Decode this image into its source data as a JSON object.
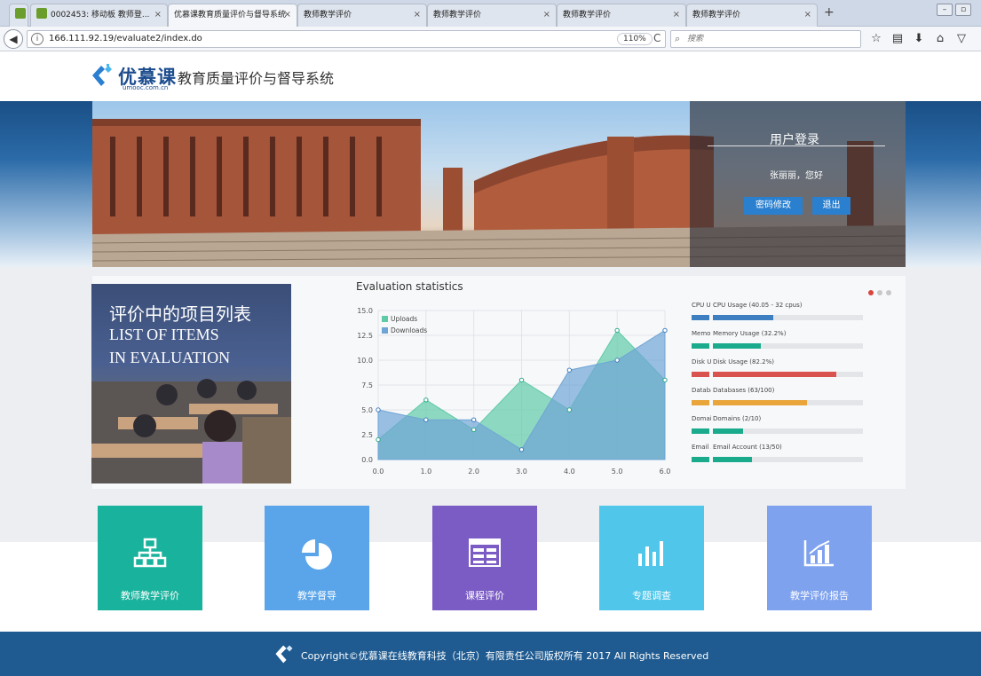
{
  "browser": {
    "tabs": [
      {
        "label": "0002453: 移动板 教师登...",
        "close": "×"
      },
      {
        "label": "优慕课教育质量评价与督导系统",
        "close": "×"
      },
      {
        "label": "教师教学评价",
        "close": "×"
      },
      {
        "label": "教师教学评价",
        "close": "×"
      },
      {
        "label": "教师教学评价",
        "close": "×"
      },
      {
        "label": "教师教学评价",
        "close": "×"
      }
    ],
    "new_tab": "+",
    "url": "166.111.92.19/evaluate2/index.do",
    "zoom": "110%",
    "search_placeholder": "搜索"
  },
  "header": {
    "logo_text": "优慕课",
    "logo_sub": "umooc.com.cn",
    "title": "教育质量评价与督导系统"
  },
  "login": {
    "title": "用户登录",
    "greeting": "张丽丽，您好",
    "change_password": "密码修改",
    "logout": "退出"
  },
  "evaluation_image": {
    "title_cn": "评价中的项目列表",
    "title_en_1": "LIST OF ITEMS",
    "title_en_2": "IN EVALUATION"
  },
  "stats": {
    "title": "Evaluation statistics",
    "colors": {
      "uploads": "#5fcaa6",
      "downloads": "#6fa5d6"
    }
  },
  "chart_data": {
    "type": "area",
    "x": [
      0.0,
      1.0,
      2.0,
      3.0,
      4.0,
      5.0,
      6.0
    ],
    "x_tick_labels": [
      "0.0",
      "1.0",
      "2.0",
      "3.0",
      "4.0",
      "5.0",
      "6.0"
    ],
    "y_tick_labels": [
      "0.0",
      "2.5",
      "5.0",
      "7.5",
      "10.0",
      "12.5",
      "15.0"
    ],
    "ylim": [
      0,
      15
    ],
    "xlim": [
      0,
      6
    ],
    "grid": true,
    "legend_position": "top-left",
    "series": [
      {
        "name": "Uploads",
        "values": [
          2,
          6,
          3,
          8,
          5,
          13,
          8
        ]
      },
      {
        "name": "Downloads",
        "values": [
          5,
          4,
          4,
          1,
          9,
          10,
          13
        ]
      }
    ]
  },
  "usage": [
    {
      "short": "CPU Usage",
      "label": "CPU Usage (40.05 - 32 cpus)",
      "percent": 40,
      "color": "#3d7fc1"
    },
    {
      "short": "Memory Usage",
      "label": "Memory Usage (32.2%)",
      "percent": 32.2,
      "color": "#1aaa8c"
    },
    {
      "short": "Disk Usage",
      "label": "Disk Usage (82.2%)",
      "percent": 82.2,
      "color": "#d9534f"
    },
    {
      "short": "Databases",
      "label": "Databases (63/100)",
      "percent": 63,
      "color": "#e9a43a"
    },
    {
      "short": "Domains",
      "label": "Domains (2/10)",
      "percent": 20,
      "color": "#1aaa8c"
    },
    {
      "short": "Email Account",
      "label": "Email Account (13/50)",
      "percent": 26,
      "color": "#1aaa8c"
    }
  ],
  "tiles": [
    {
      "label": "教师教学评价",
      "color": "#19b29c",
      "icon": "sitemap-icon"
    },
    {
      "label": "教学督导",
      "color": "#5aa5ea",
      "icon": "pie-chart-icon"
    },
    {
      "label": "课程评价",
      "color": "#7b5cc4",
      "icon": "window-table-icon"
    },
    {
      "label": "专题调查",
      "color": "#4fc6ea",
      "icon": "bar-chart-icon"
    },
    {
      "label": "教学评价报告",
      "color": "#7fa2ee",
      "icon": "growth-chart-icon"
    }
  ],
  "footer": {
    "copyright": "Copyright©优慕课在线教育科技（北京）有限责任公司版权所有 2017 All Rights Reserved"
  }
}
